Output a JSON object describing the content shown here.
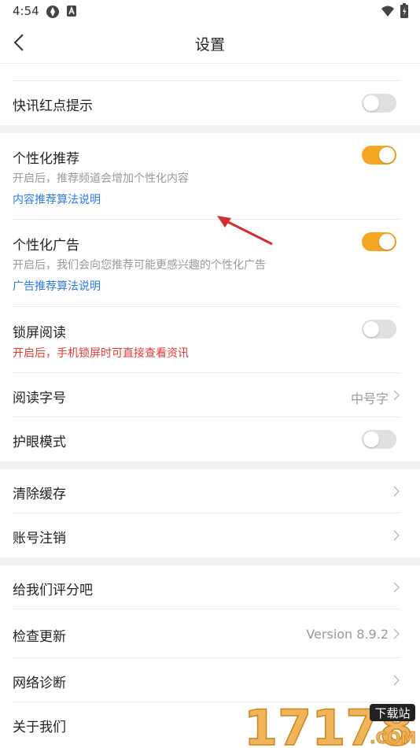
{
  "status": {
    "time": "4:54"
  },
  "nav": {
    "title": "设置"
  },
  "rows": {
    "news_red_dot": {
      "label": "快讯红点提示",
      "enabled": false
    },
    "personalized": {
      "label": "个性化推荐",
      "desc": "开启后，推荐频道会增加个性化内容",
      "link": "内容推荐算法说明",
      "enabled": true
    },
    "ads": {
      "label": "个性化广告",
      "desc": "开启后，我们会向您推荐可能更感兴趣的个性化广告",
      "link": "广告推荐算法说明",
      "enabled": true
    },
    "lockscreen": {
      "label": "锁屏阅读",
      "desc": "开启后，手机锁屏时可直接查看资讯",
      "enabled": false
    },
    "font_size": {
      "label": "阅读字号",
      "value": "中号字"
    },
    "eye_care": {
      "label": "护眼模式",
      "enabled": false
    },
    "clear_cache": {
      "label": "清除缓存"
    },
    "cancel_account": {
      "label": "账号注销"
    },
    "rate_us": {
      "label": "给我们评分吧"
    },
    "check_update": {
      "label": "检查更新",
      "value": "Version 8.9.2"
    },
    "network_diag": {
      "label": "网络诊断"
    },
    "about": {
      "label": "关于我们"
    }
  },
  "watermark": {
    "text": "17178",
    "tag": "下载站",
    "suffix": ".COM"
  },
  "colors": {
    "accent": "#f5a623",
    "link": "#2a7be4",
    "warn": "#e53935"
  }
}
